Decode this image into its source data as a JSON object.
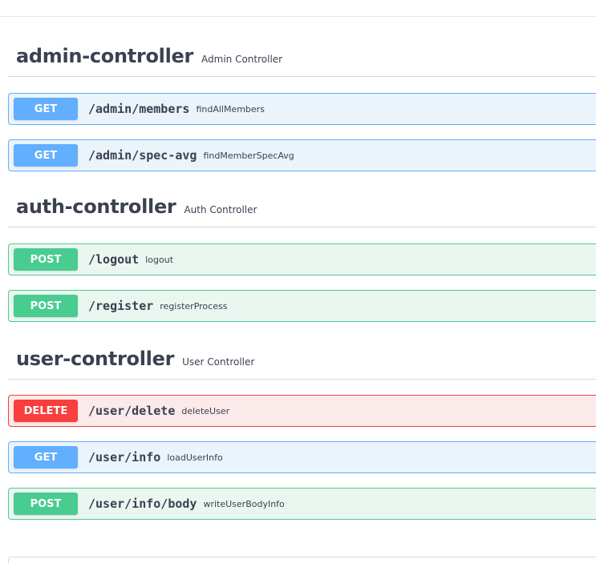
{
  "sections": [
    {
      "name": "admin-controller",
      "description": "Admin Controller",
      "operations": [
        {
          "method": "GET",
          "path": "/admin/members",
          "summary": "findAllMembers"
        },
        {
          "method": "GET",
          "path": "/admin/spec-avg",
          "summary": "findMemberSpecAvg"
        }
      ]
    },
    {
      "name": "auth-controller",
      "description": "Auth Controller",
      "operations": [
        {
          "method": "POST",
          "path": "/logout",
          "summary": "logout"
        },
        {
          "method": "POST",
          "path": "/register",
          "summary": "registerProcess"
        }
      ]
    },
    {
      "name": "user-controller",
      "description": "User Controller",
      "operations": [
        {
          "method": "DELETE",
          "path": "/user/delete",
          "summary": "deleteUser"
        },
        {
          "method": "GET",
          "path": "/user/info",
          "summary": "loadUserInfo"
        },
        {
          "method": "POST",
          "path": "/user/info/body",
          "summary": "writeUserBodyInfo"
        }
      ]
    }
  ],
  "colors": {
    "get": "#61affe",
    "post": "#49cc90",
    "delete": "#f93e3e",
    "text": "#3b4151"
  }
}
